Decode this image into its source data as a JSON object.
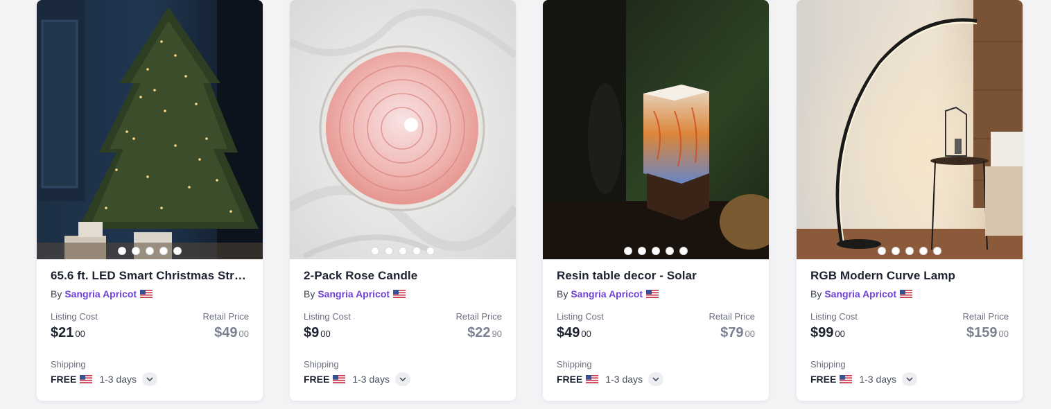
{
  "products": [
    {
      "title": "65.6 ft. LED Smart Christmas Str…",
      "by_label": "By",
      "seller": "Sangria Apricot",
      "listing_label": "Listing Cost",
      "listing_dollars": "$21",
      "listing_cents": "00",
      "retail_label": "Retail Price",
      "retail_dollars": "$49",
      "retail_cents": "00",
      "shipping_label": "Shipping",
      "shipping_free": "FREE",
      "shipping_days": "1-3 days",
      "image_icon": "christmas-tree-image",
      "carousel_dots": 5
    },
    {
      "title": "2-Pack Rose Candle",
      "by_label": "By",
      "seller": "Sangria Apricot",
      "listing_label": "Listing Cost",
      "listing_dollars": "$9",
      "listing_cents": "00",
      "retail_label": "Retail Price",
      "retail_dollars": "$22",
      "retail_cents": "90",
      "shipping_label": "Shipping",
      "shipping_free": "FREE",
      "shipping_days": "1-3 days",
      "image_icon": "rose-candle-image",
      "carousel_dots": 5
    },
    {
      "title": "Resin table decor - Solar",
      "by_label": "By",
      "seller": "Sangria Apricot",
      "listing_label": "Listing Cost",
      "listing_dollars": "$49",
      "listing_cents": "00",
      "retail_label": "Retail Price",
      "retail_dollars": "$79",
      "retail_cents": "00",
      "shipping_label": "Shipping",
      "shipping_free": "FREE",
      "shipping_days": "1-3 days",
      "image_icon": "resin-lamp-image",
      "carousel_dots": 5
    },
    {
      "title": "RGB Modern Curve Lamp",
      "by_label": "By",
      "seller": "Sangria Apricot",
      "listing_label": "Listing Cost",
      "listing_dollars": "$99",
      "listing_cents": "00",
      "retail_label": "Retail Price",
      "retail_dollars": "$159",
      "retail_cents": "00",
      "shipping_label": "Shipping",
      "shipping_free": "FREE",
      "shipping_days": "1-3 days",
      "image_icon": "curve-lamp-image",
      "carousel_dots": 5
    }
  ],
  "colors": {
    "seller_link": "#6f42d6",
    "page_bg": "#f3f3f6"
  }
}
